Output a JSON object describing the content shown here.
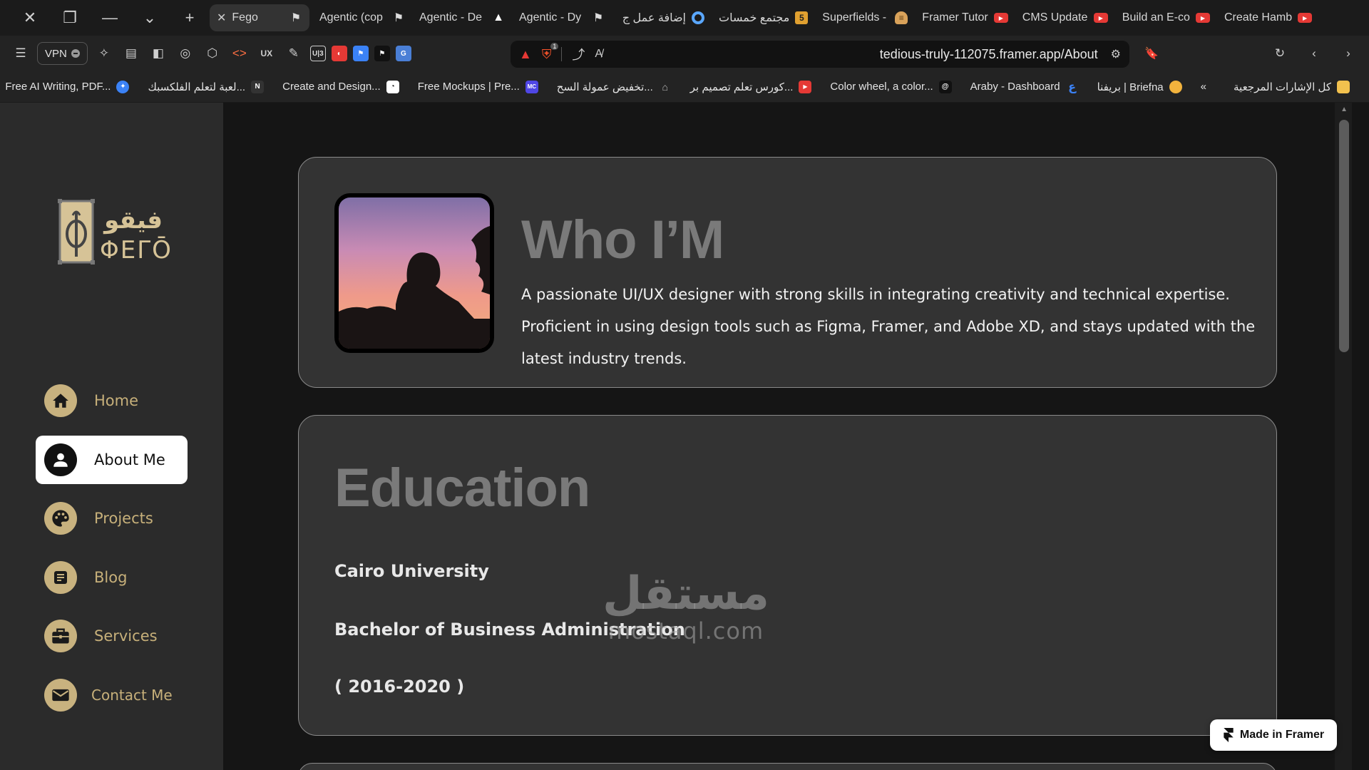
{
  "browser": {
    "tabs": [
      {
        "label": "Fego",
        "active": true,
        "icon": "framer-icon"
      },
      {
        "label": "Agentic (cop",
        "icon": "framer-icon"
      },
      {
        "label": "Agentic - De",
        "icon": "adobe-icon"
      },
      {
        "label": "Agentic - Dy",
        "icon": "framer-icon"
      },
      {
        "label": "إضافة عمل ج",
        "icon": "ring-icon"
      },
      {
        "label": "مجتمع خمسات",
        "icon": "five-icon"
      },
      {
        "label": "Superfields -",
        "icon": "burger-icon"
      },
      {
        "label": "Framer Tutor",
        "icon": "youtube-icon"
      },
      {
        "label": "CMS Update",
        "icon": "youtube-icon"
      },
      {
        "label": "Build an E-co",
        "icon": "youtube-icon"
      },
      {
        "label": "Create Hamb",
        "icon": "youtube-icon"
      }
    ],
    "vpn_label": "VPN",
    "ext_ux": "UX",
    "ext_u3": "U|3",
    "brave_badge": "1",
    "url": "tedious-truly-112075.framer.app/About",
    "bookmarks": [
      {
        "label": "كل الإشارات المرجعية",
        "icon": "folder-icon",
        "color": "#f2c14e"
      },
      {
        "label": "بريفنا | Briefna",
        "icon": "briefna-icon",
        "color": "#f2b33d"
      },
      {
        "label": "Araby - Dashboard",
        "icon": "araby-icon",
        "color": "#3b82f6"
      },
      {
        "label": "Color wheel, a color...",
        "icon": "color-wheel-icon",
        "color": "#111111"
      },
      {
        "label": "كورس تعلم تصميم بر...",
        "icon": "youtube-icon",
        "color": "#e53935"
      },
      {
        "label": "تخفيض عمولة السح...",
        "icon": "bank-icon",
        "color": "#9e9e9e"
      },
      {
        "label": "Free Mockups | Pre...",
        "icon": "mc-icon",
        "color": "#4f46e5"
      },
      {
        "label": "Create and Design...",
        "icon": "design-icon",
        "color": "#ffffff"
      },
      {
        "label": "لعبة لتعلم الفلكسبك...",
        "icon": "notion-icon",
        "color": "#333333"
      },
      {
        "label": "Free AI Writing, PDF...",
        "icon": "ai-icon",
        "color": "#3b82f6"
      }
    ]
  },
  "sidebar": {
    "logo_ar": "فيقو",
    "logo_en": "ΦΕΓŌ",
    "items": [
      {
        "label": "Home",
        "icon": "home-icon",
        "active": false
      },
      {
        "label": "About Me",
        "icon": "user-icon",
        "active": true
      },
      {
        "label": "Projects",
        "icon": "palette-icon",
        "active": false
      },
      {
        "label": "Blog",
        "icon": "document-icon",
        "active": false
      },
      {
        "label": "Services",
        "icon": "briefcase-icon",
        "active": false
      },
      {
        "label": "Contact Me",
        "icon": "mail-icon",
        "active": false
      }
    ]
  },
  "about": {
    "title": "Who I’M",
    "description": "A passionate UI/UX designer with strong skills in integrating creativity and technical expertise. Proficient in using design tools such as Figma, Framer, and Adobe XD, and stays updated with the latest industry trends."
  },
  "education": {
    "title": "Education",
    "university": "Cairo University",
    "degree": "Bachelor of Business Administration",
    "years": "( 2016-2020 )"
  },
  "watermark": {
    "ar": "مستقل",
    "en": "mostaql.com"
  },
  "framer_badge": "Made in Framer",
  "colors": {
    "accent_gold": "#c8b27f",
    "sidebar_bg": "#2b2b2b",
    "card_bg": "#333333",
    "heading_gray": "#7a7a7a"
  }
}
